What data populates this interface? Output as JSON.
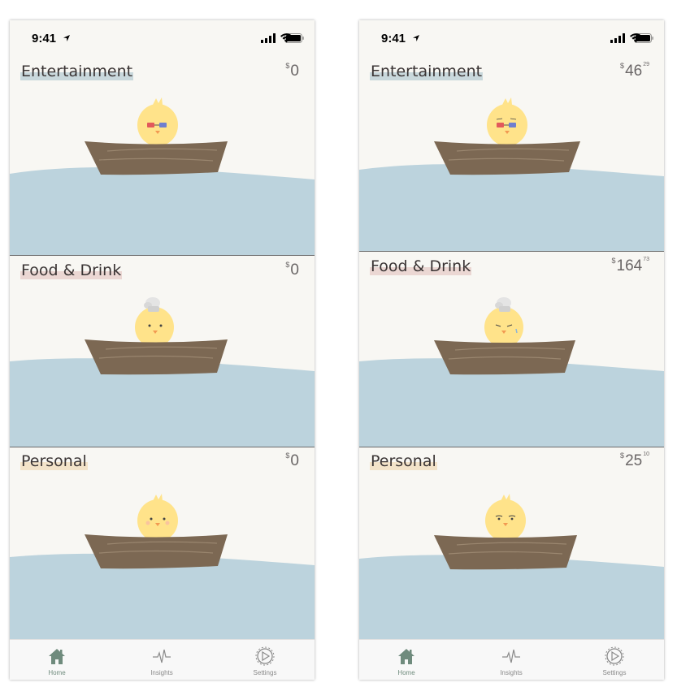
{
  "status": {
    "time": "9:41"
  },
  "colors": {
    "bg": "#f8f7f3",
    "water": "#bcd3dd",
    "boat": "#7c6853",
    "chick": "#ffe38a",
    "entertainment_highlight": "#c9d8dc",
    "food_highlight": "#ebd7d3",
    "personal_highlight": "#f3e3c9",
    "active_tab": "#6f8b7d"
  },
  "screens": [
    {
      "categories": [
        {
          "title": "Entertainment",
          "currency": "$",
          "dollars": "0",
          "cents": ""
        },
        {
          "title": "Food & Drink",
          "currency": "$",
          "dollars": "0",
          "cents": ""
        },
        {
          "title": "Personal",
          "currency": "$",
          "dollars": "0",
          "cents": ""
        }
      ]
    },
    {
      "categories": [
        {
          "title": "Entertainment",
          "currency": "$",
          "dollars": "46",
          "cents": "29"
        },
        {
          "title": "Food & Drink",
          "currency": "$",
          "dollars": "164",
          "cents": "73"
        },
        {
          "title": "Personal",
          "currency": "$",
          "dollars": "25",
          "cents": "10"
        }
      ]
    }
  ],
  "tabs": [
    {
      "label": "Home",
      "icon": "home-icon",
      "active": true
    },
    {
      "label": "Insights",
      "icon": "pulse-icon",
      "active": false
    },
    {
      "label": "Settings",
      "icon": "settings-icon",
      "active": false
    }
  ]
}
